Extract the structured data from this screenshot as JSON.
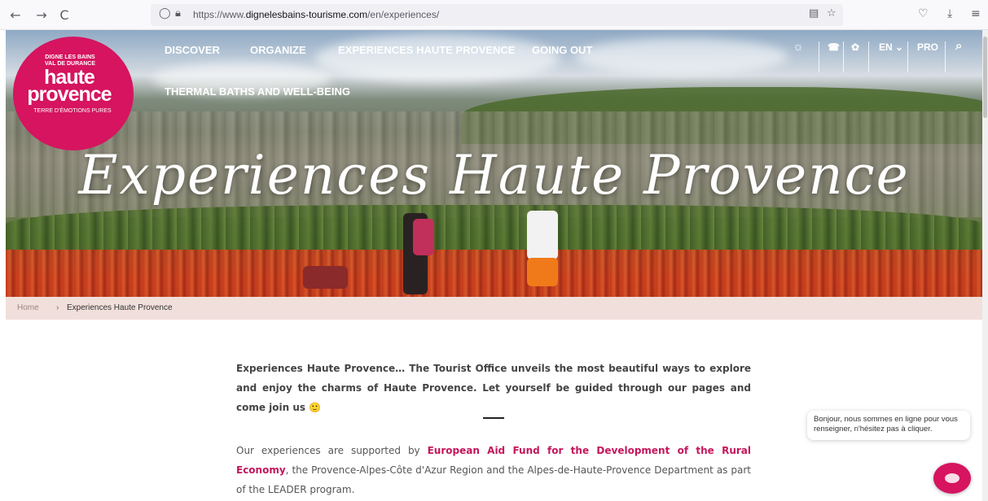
{
  "browser": {
    "url_prefix": "https://www.",
    "url_domain": "dignelesbains-tourisme.com",
    "url_path": "/en/experiences/",
    "back_icon": "←",
    "forward_icon": "→",
    "reload_icon": "C",
    "shield_icon": "◯",
    "lock_icon": "🔒︎",
    "reader_icon": "▤",
    "star_icon": "☆",
    "pocket_icon": "♡",
    "download_icon": "⤓",
    "menu_icon": "≡"
  },
  "logo": {
    "small_line1": "DIGNE LES BAINS",
    "small_line2": "VAL DE DURANCE",
    "big_line1": "haute",
    "big_line2": "provence",
    "tagline": "TERRE D'ÉMOTIONS PURES",
    "color": "#d6145f"
  },
  "menu": {
    "items": [
      "DISCOVER",
      "ORGANIZE",
      "EXPERIENCES HAUTE PROVENCE",
      "GOING OUT",
      "THERMAL BATHS AND WELL-BEING"
    ]
  },
  "utility": {
    "weather_icon": "☼",
    "phone_icon": "☎",
    "flower_icon": "✿",
    "lang": "EN ⌄",
    "pro": "PRO",
    "search_icon": "⌕"
  },
  "hero": {
    "title": "Experiences Haute Provence"
  },
  "breadcrumb": {
    "home": "Home",
    "separator": "›",
    "current": "Experiences Haute Provence"
  },
  "content": {
    "intro": "Experiences Haute Provence… The Tourist Office unveils the most beautiful ways to explore and enjoy the charms of Haute Provence. Let yourself be guided through our pages and come join us 🙂",
    "support_before": "Our experiences are supported by ",
    "support_link": "European Aid Fund for the Development of the Rural Economy",
    "support_after": ", the Provence-Alpes-Côte d'Azur Region and the Alpes-de-Haute-Provence Department as part of the LEADER program."
  },
  "chat": {
    "message": "Bonjour, nous sommes en ligne pour vous renseigner, n'hésitez pas à cliquer."
  }
}
